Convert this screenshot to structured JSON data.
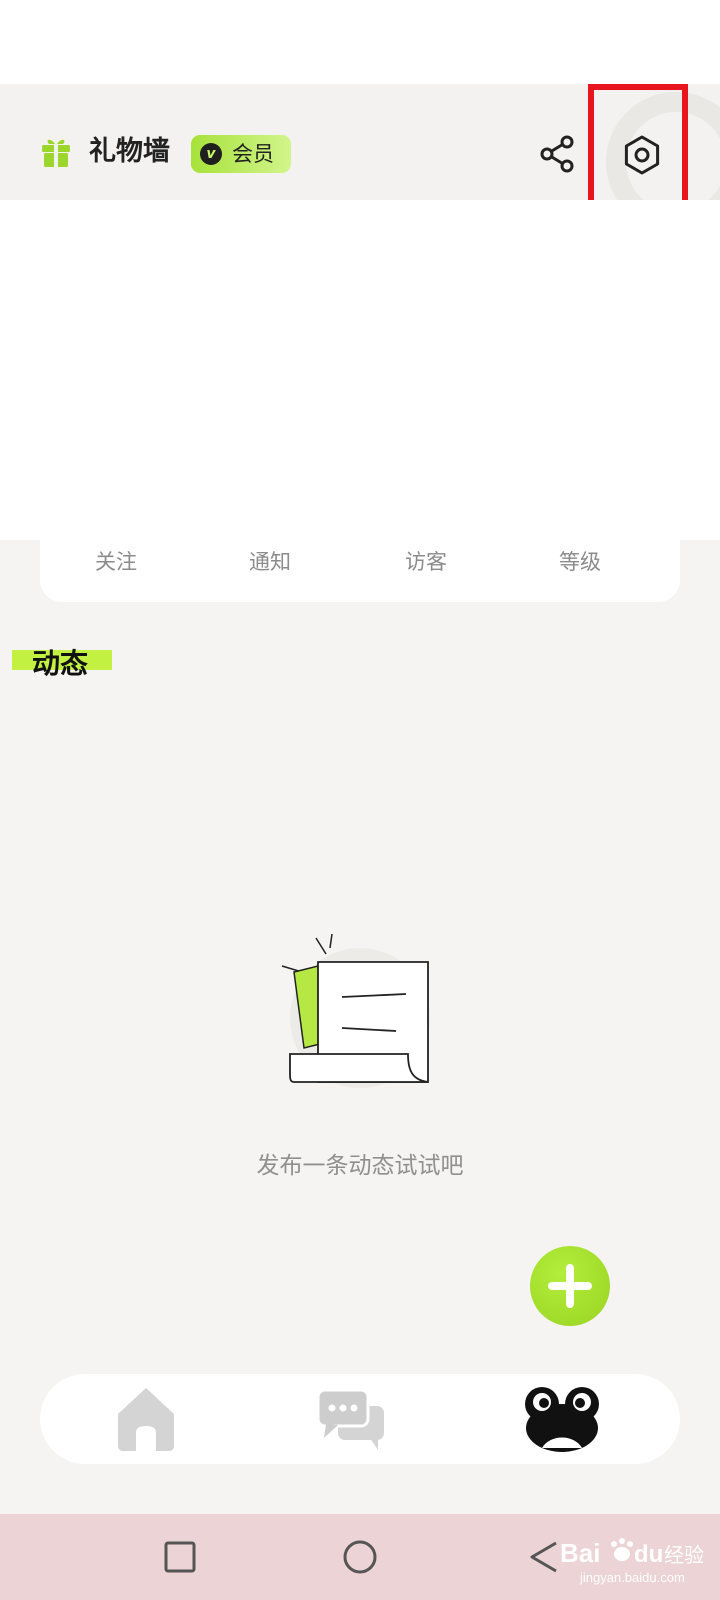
{
  "header": {
    "gift_icon": "gift-icon",
    "title": "礼物墙",
    "vip_letter": "v",
    "vip_label": "会员",
    "share_icon": "share-icon",
    "settings_icon": "settings-icon"
  },
  "stats": {
    "items": [
      {
        "label": "关注"
      },
      {
        "label": "通知"
      },
      {
        "label": "访客"
      },
      {
        "label": "等级"
      }
    ]
  },
  "moments": {
    "title": "动态",
    "empty_text": "发布一条动态试试吧",
    "add_icon": "plus-icon"
  },
  "bottom_nav": {
    "items": [
      {
        "icon": "home-icon"
      },
      {
        "icon": "chat-icon"
      },
      {
        "icon": "frog-profile-icon"
      }
    ]
  },
  "system_nav": {
    "items": [
      {
        "icon": "recent-apps-icon"
      },
      {
        "icon": "home-circle-icon"
      },
      {
        "icon": "back-icon"
      }
    ]
  },
  "watermark": {
    "brand": "Bai",
    "brand_cn": "经验",
    "url": "jingyan.baidu.com"
  },
  "colors": {
    "accent": "#a7e23a",
    "highlight_box": "#e8151d",
    "background": "#f5f4f2"
  }
}
